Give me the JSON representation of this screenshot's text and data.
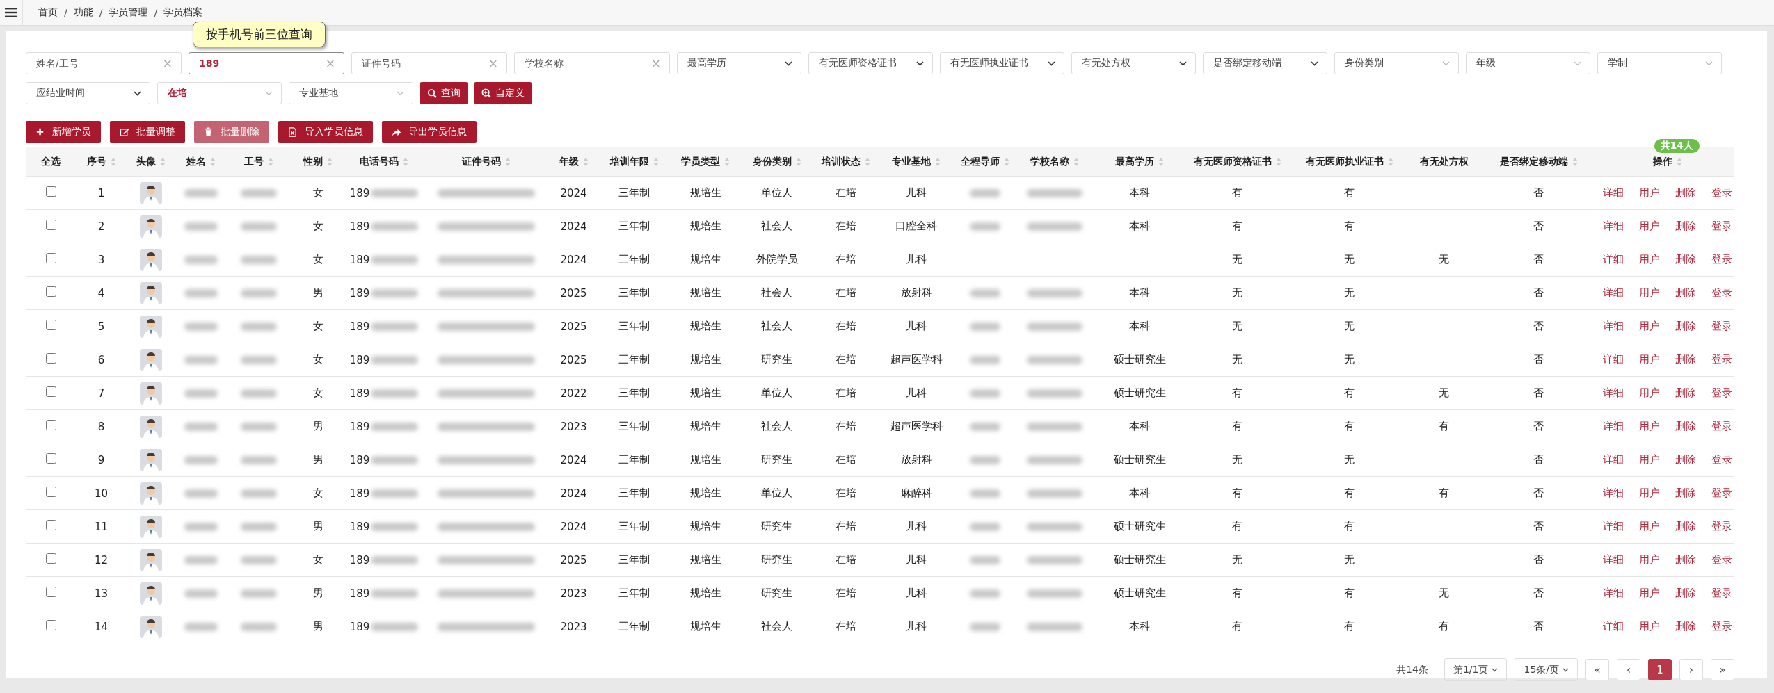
{
  "breadcrumb": {
    "separator": "/",
    "items": [
      "首页",
      "功能",
      "学员管理",
      "学员档案"
    ]
  },
  "filters": [
    {
      "kind": "input",
      "placeholder": "姓名/工号",
      "clear": "×",
      "focused": false
    },
    {
      "kind": "input",
      "value": "189",
      "clear": "×",
      "focused": true,
      "tooltip": "按手机号前三位查询"
    },
    {
      "kind": "input",
      "placeholder": "证件号码",
      "clear": "×",
      "focused": false
    },
    {
      "kind": "input",
      "placeholder": "学校名称",
      "clear": "×",
      "focused": false
    },
    {
      "kind": "select",
      "placeholder": "最高学历"
    },
    {
      "kind": "select",
      "placeholder": "有无医师资格证书"
    },
    {
      "kind": "select",
      "placeholder": "有无医师执业证书"
    },
    {
      "kind": "select",
      "placeholder": "有无处方权"
    },
    {
      "kind": "select",
      "placeholder": "是否绑定移动端"
    },
    {
      "kind": "dropdown",
      "placeholder": "身份类别"
    },
    {
      "kind": "dropdown",
      "placeholder": "年级"
    },
    {
      "kind": "dropdown",
      "placeholder": "学制"
    },
    {
      "kind": "select",
      "placeholder": "应结业时间"
    },
    {
      "kind": "dropdown",
      "value": "在培"
    },
    {
      "kind": "dropdown",
      "placeholder": "专业基地"
    }
  ],
  "search_buttons": [
    "查询",
    "自定义"
  ],
  "actions": [
    {
      "label": "新增学员",
      "disabled": false
    },
    {
      "label": "批量调整",
      "disabled": false
    },
    {
      "label": "批量删除",
      "disabled": true
    },
    {
      "label": "导入学员信息",
      "disabled": false
    },
    {
      "label": "导出学员信息",
      "disabled": false
    }
  ],
  "total_badge": "共14人",
  "table": {
    "columns": [
      {
        "label": "全选",
        "sortable": false
      },
      {
        "label": "序号",
        "sortable": true
      },
      {
        "label": "头像",
        "sortable": true
      },
      {
        "label": "姓名",
        "sortable": true
      },
      {
        "label": "工号",
        "sortable": true
      },
      {
        "label": "性别",
        "sortable": true
      },
      {
        "label": "电话号码",
        "sortable": true
      },
      {
        "label": "证件号码",
        "sortable": true
      },
      {
        "label": "年级",
        "sortable": true
      },
      {
        "label": "培训年限",
        "sortable": true
      },
      {
        "label": "学员类型",
        "sortable": true
      },
      {
        "label": "身份类别",
        "sortable": true
      },
      {
        "label": "培训状态",
        "sortable": true
      },
      {
        "label": "专业基地",
        "sortable": true
      },
      {
        "label": "全程导师",
        "sortable": true
      },
      {
        "label": "学校名称",
        "sortable": true
      },
      {
        "label": "最高学历",
        "sortable": true
      },
      {
        "label": "有无医师资格证书",
        "sortable": true
      },
      {
        "label": "有无医师执业证书",
        "sortable": true
      },
      {
        "label": "有无处方权",
        "sortable": false
      },
      {
        "label": "是否绑定移动端",
        "sortable": true
      },
      {
        "label": "操作",
        "sortable": true
      }
    ],
    "rows": [
      {
        "checked": false,
        "cells": [
          {
            "kind": "checkbox"
          },
          "1",
          {
            "kind": "avatar"
          },
          {
            "kind": "redacted"
          },
          {
            "kind": "redacted"
          },
          "女",
          {
            "kind": "partial",
            "text": "189"
          },
          {
            "kind": "redacted"
          },
          "2024",
          "三年制",
          "规培生",
          "单位人",
          "在培",
          "儿科",
          {
            "kind": "redacted"
          },
          {
            "kind": "redacted"
          },
          "本科",
          "有",
          "有",
          null,
          "否",
          {
            "kind": "links",
            "links": [
              "详细",
              "用户",
              "删除",
              "登录"
            ]
          }
        ]
      },
      {
        "checked": false,
        "cells": [
          {
            "kind": "checkbox"
          },
          "2",
          {
            "kind": "avatar"
          },
          {
            "kind": "redacted"
          },
          {
            "kind": "redacted"
          },
          "女",
          {
            "kind": "partial",
            "text": "189"
          },
          {
            "kind": "redacted"
          },
          "2024",
          "三年制",
          "规培生",
          "社会人",
          "在培",
          "口腔全科",
          {
            "kind": "redacted"
          },
          {
            "kind": "redacted"
          },
          "本科",
          "有",
          "有",
          null,
          "否",
          {
            "kind": "links",
            "links": [
              "详细",
              "用户",
              "删除",
              "登录"
            ]
          }
        ]
      },
      {
        "checked": false,
        "cells": [
          {
            "kind": "checkbox"
          },
          "3",
          {
            "kind": "avatar"
          },
          {
            "kind": "redacted"
          },
          {
            "kind": "redacted"
          },
          "女",
          {
            "kind": "partial",
            "text": "189"
          },
          {
            "kind": "redacted"
          },
          "2024",
          "三年制",
          "规培生",
          "外院学员",
          "在培",
          "儿科",
          null,
          null,
          null,
          "无",
          "无",
          "无",
          "否",
          {
            "kind": "links",
            "links": [
              "详细",
              "用户",
              "删除",
              "登录"
            ]
          }
        ]
      },
      {
        "checked": false,
        "cells": [
          {
            "kind": "checkbox"
          },
          "4",
          {
            "kind": "avatar"
          },
          {
            "kind": "redacted"
          },
          {
            "kind": "redacted"
          },
          "男",
          {
            "kind": "partial",
            "text": "189"
          },
          {
            "kind": "redacted"
          },
          "2025",
          "三年制",
          "规培生",
          "社会人",
          "在培",
          "放射科",
          {
            "kind": "redacted"
          },
          {
            "kind": "redacted"
          },
          "本科",
          "无",
          "无",
          null,
          "否",
          {
            "kind": "links",
            "links": [
              "详细",
              "用户",
              "删除",
              "登录"
            ]
          }
        ]
      },
      {
        "checked": false,
        "cells": [
          {
            "kind": "checkbox"
          },
          "5",
          {
            "kind": "avatar"
          },
          {
            "kind": "redacted"
          },
          {
            "kind": "redacted"
          },
          "女",
          {
            "kind": "partial",
            "text": "189"
          },
          {
            "kind": "redacted"
          },
          "2025",
          "三年制",
          "规培生",
          "社会人",
          "在培",
          "儿科",
          {
            "kind": "redacted"
          },
          {
            "kind": "redacted"
          },
          "本科",
          "无",
          "无",
          null,
          "否",
          {
            "kind": "links",
            "links": [
              "详细",
              "用户",
              "删除",
              "登录"
            ]
          }
        ]
      },
      {
        "checked": false,
        "cells": [
          {
            "kind": "checkbox"
          },
          "6",
          {
            "kind": "avatar"
          },
          {
            "kind": "redacted"
          },
          {
            "kind": "redacted"
          },
          "女",
          {
            "kind": "partial",
            "text": "189"
          },
          {
            "kind": "redacted"
          },
          "2025",
          "三年制",
          "规培生",
          "研究生",
          "在培",
          "超声医学科",
          {
            "kind": "redacted"
          },
          {
            "kind": "redacted"
          },
          "硕士研究生",
          "无",
          "无",
          null,
          "否",
          {
            "kind": "links",
            "links": [
              "详细",
              "用户",
              "删除",
              "登录"
            ]
          }
        ]
      },
      {
        "checked": false,
        "cells": [
          {
            "kind": "checkbox"
          },
          "7",
          {
            "kind": "avatar"
          },
          {
            "kind": "redacted"
          },
          {
            "kind": "redacted"
          },
          "女",
          {
            "kind": "partial",
            "text": "189"
          },
          {
            "kind": "redacted"
          },
          "2022",
          "三年制",
          "规培生",
          "单位人",
          "在培",
          "儿科",
          {
            "kind": "redacted"
          },
          {
            "kind": "redacted"
          },
          "硕士研究生",
          "有",
          "有",
          "无",
          "否",
          {
            "kind": "links",
            "links": [
              "详细",
              "用户",
              "删除",
              "登录"
            ]
          }
        ]
      },
      {
        "checked": false,
        "cells": [
          {
            "kind": "checkbox"
          },
          "8",
          {
            "kind": "avatar"
          },
          {
            "kind": "redacted"
          },
          {
            "kind": "redacted"
          },
          "男",
          {
            "kind": "partial",
            "text": "189"
          },
          {
            "kind": "redacted"
          },
          "2023",
          "三年制",
          "规培生",
          "社会人",
          "在培",
          "超声医学科",
          {
            "kind": "redacted"
          },
          {
            "kind": "redacted"
          },
          "本科",
          "有",
          "有",
          "有",
          "否",
          {
            "kind": "links",
            "links": [
              "详细",
              "用户",
              "删除",
              "登录"
            ]
          }
        ]
      },
      {
        "checked": false,
        "cells": [
          {
            "kind": "checkbox"
          },
          "9",
          {
            "kind": "avatar"
          },
          {
            "kind": "redacted"
          },
          {
            "kind": "redacted"
          },
          "男",
          {
            "kind": "partial",
            "text": "189"
          },
          {
            "kind": "redacted"
          },
          "2024",
          "三年制",
          "规培生",
          "研究生",
          "在培",
          "放射科",
          {
            "kind": "redacted"
          },
          {
            "kind": "redacted"
          },
          "硕士研究生",
          "无",
          "无",
          null,
          "否",
          {
            "kind": "links",
            "links": [
              "详细",
              "用户",
              "删除",
              "登录"
            ]
          }
        ]
      },
      {
        "checked": false,
        "cells": [
          {
            "kind": "checkbox"
          },
          "10",
          {
            "kind": "avatar"
          },
          {
            "kind": "redacted"
          },
          {
            "kind": "redacted"
          },
          "女",
          {
            "kind": "partial",
            "text": "189"
          },
          {
            "kind": "redacted"
          },
          "2024",
          "三年制",
          "规培生",
          "单位人",
          "在培",
          "麻醉科",
          {
            "kind": "redacted"
          },
          {
            "kind": "redacted"
          },
          "本科",
          "有",
          "有",
          "有",
          "否",
          {
            "kind": "links",
            "links": [
              "详细",
              "用户",
              "删除",
              "登录"
            ]
          }
        ]
      },
      {
        "checked": false,
        "cells": [
          {
            "kind": "checkbox"
          },
          "11",
          {
            "kind": "avatar"
          },
          {
            "kind": "redacted"
          },
          {
            "kind": "redacted"
          },
          "男",
          {
            "kind": "partial",
            "text": "189"
          },
          {
            "kind": "redacted"
          },
          "2024",
          "三年制",
          "规培生",
          "研究生",
          "在培",
          "儿科",
          {
            "kind": "redacted"
          },
          {
            "kind": "redacted"
          },
          "硕士研究生",
          "有",
          "有",
          null,
          "否",
          {
            "kind": "links",
            "links": [
              "详细",
              "用户",
              "删除",
              "登录"
            ]
          }
        ]
      },
      {
        "checked": false,
        "cells": [
          {
            "kind": "checkbox"
          },
          "12",
          {
            "kind": "avatar"
          },
          {
            "kind": "redacted"
          },
          {
            "kind": "redacted"
          },
          "女",
          {
            "kind": "partial",
            "text": "189"
          },
          {
            "kind": "redacted"
          },
          "2025",
          "三年制",
          "规培生",
          "研究生",
          "在培",
          "儿科",
          {
            "kind": "redacted"
          },
          {
            "kind": "redacted"
          },
          "硕士研究生",
          "无",
          "无",
          null,
          "否",
          {
            "kind": "links",
            "links": [
              "详细",
              "用户",
              "删除",
              "登录"
            ]
          }
        ]
      },
      {
        "checked": false,
        "cells": [
          {
            "kind": "checkbox"
          },
          "13",
          {
            "kind": "avatar"
          },
          {
            "kind": "redacted"
          },
          {
            "kind": "redacted"
          },
          "男",
          {
            "kind": "partial",
            "text": "189"
          },
          {
            "kind": "redacted"
          },
          "2023",
          "三年制",
          "规培生",
          "研究生",
          "在培",
          "儿科",
          {
            "kind": "redacted"
          },
          {
            "kind": "redacted"
          },
          "硕士研究生",
          "有",
          "有",
          "无",
          "否",
          {
            "kind": "links",
            "links": [
              "详细",
              "用户",
              "删除",
              "登录"
            ]
          }
        ]
      },
      {
        "checked": false,
        "cells": [
          {
            "kind": "checkbox"
          },
          "14",
          {
            "kind": "avatar"
          },
          {
            "kind": "redacted"
          },
          {
            "kind": "redacted"
          },
          "男",
          {
            "kind": "partial",
            "text": "189"
          },
          {
            "kind": "redacted"
          },
          "2023",
          "三年制",
          "规培生",
          "社会人",
          "在培",
          "儿科",
          {
            "kind": "redacted"
          },
          {
            "kind": "redacted"
          },
          "本科",
          "有",
          "有",
          "有",
          "否",
          {
            "kind": "links",
            "links": [
              "详细",
              "用户",
              "删除",
              "登录"
            ]
          }
        ]
      }
    ]
  },
  "pagination": {
    "total": "共14条",
    "page_select": "第1/1页",
    "size_select": "15条/页",
    "buttons": [
      {
        "label": "«",
        "selected": false
      },
      {
        "label": "‹",
        "selected": false
      },
      {
        "label": "1",
        "selected": true
      },
      {
        "label": "›",
        "selected": false
      },
      {
        "label": "»",
        "selected": false
      }
    ]
  }
}
